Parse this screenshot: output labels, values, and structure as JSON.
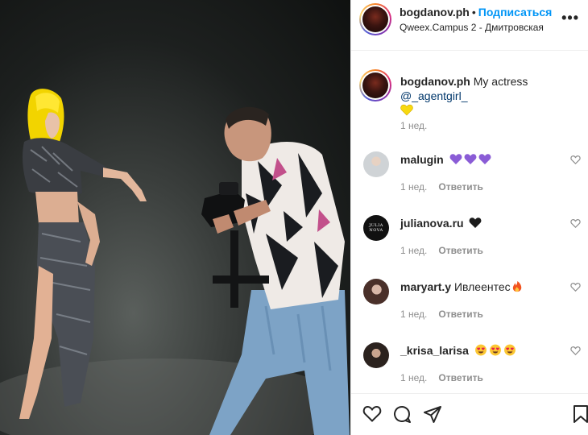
{
  "post": {
    "author": "bogdanov.ph",
    "separator": "•",
    "follow_label": "Подписаться",
    "location": "Qweex.Campus 2 - Дмитровская",
    "more_label": "•••"
  },
  "caption": {
    "author": "bogdanov.ph",
    "text": "My actress",
    "mention": "@_agentgirl_",
    "emoji": "yellow-heart",
    "time": "1 нед."
  },
  "comments": [
    {
      "user": "malugin",
      "text": "",
      "emojis": [
        "purple-heart",
        "purple-heart",
        "purple-heart"
      ],
      "time": "1 нед.",
      "reply_label": "Ответить",
      "avatar_color": "#cfd3d6"
    },
    {
      "user": "julianova.ru",
      "text": "",
      "emojis": [
        "black-heart"
      ],
      "time": "1 нед.",
      "reply_label": "Ответить",
      "avatar_color": "#111111",
      "avatar_text": "JULIA NOVA"
    },
    {
      "user": "maryart.y",
      "text": "Ивлеентес",
      "emojis": [
        "fire"
      ],
      "time": "1 нед.",
      "reply_label": "Ответить",
      "avatar_color": "#5a3b35"
    },
    {
      "user": "_krisa_larisa",
      "text": "",
      "emojis": [
        "heart-eyes",
        "heart-eyes",
        "heart-eyes"
      ],
      "time": "1 нед.",
      "reply_label": "Ответить",
      "avatar_color": "#2b221e"
    }
  ],
  "actions": [
    "heart-icon",
    "comment-icon",
    "share-icon",
    "bookmark-icon"
  ],
  "colors": {
    "link": "#0095f6",
    "mention": "#00376b",
    "muted": "#8e8e8e",
    "text": "#262626"
  }
}
